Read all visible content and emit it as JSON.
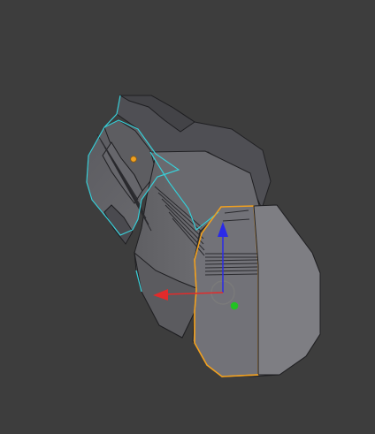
{
  "viewport": {
    "background": "#3d3d3d",
    "object_fill": "#6e6e72",
    "object_shade": "#5f5f63",
    "edge_color": "#1f1f22",
    "selected_edge_color": "#f0a020",
    "wire_color": "#39cfd8",
    "origin_color": "#f0a020",
    "gizmo_x_color": "#e22b2b",
    "gizmo_z_color": "#2a2ae8",
    "gizmo_y_dot_color": "#22c222",
    "pivot_ring_color": "#7a7a7a"
  },
  "icons": [
    "mesh-object",
    "transform-gizmo",
    "x-axis-arrow",
    "z-axis-arrow",
    "y-axis-dot",
    "pivot-ring",
    "object-origin-dot"
  ]
}
